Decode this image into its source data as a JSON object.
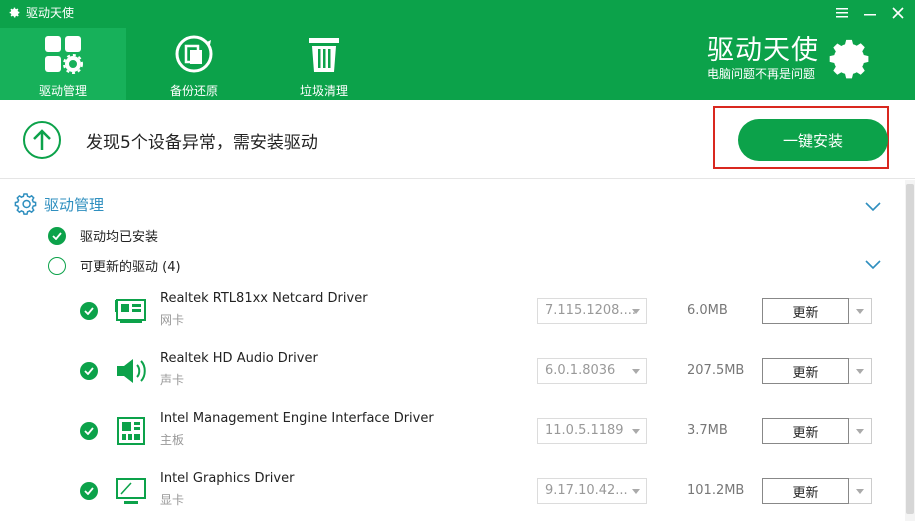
{
  "window": {
    "title": "驱动天使",
    "controls": [
      "menu-icon",
      "minimize-icon",
      "close-icon"
    ]
  },
  "nav": [
    {
      "label": "驱动管理",
      "icon": "driver-manage-icon",
      "active": true
    },
    {
      "label": "备份还原",
      "icon": "backup-restore-icon",
      "active": false
    },
    {
      "label": "垃圾清理",
      "icon": "trash-icon",
      "active": false
    }
  ],
  "brand": {
    "title": "驱动天使",
    "subtitle": "电脑问题不再是问题",
    "icon": "gear-icon"
  },
  "alert": {
    "icon": "up-arrow-circle-icon",
    "message": "发现5个设备异常，需安装驱动",
    "install_button": "一键安装"
  },
  "section": {
    "title": "驱动管理",
    "installed_label": "驱动均已安装",
    "updatable_label": "可更新的驱动 (4)"
  },
  "drivers": [
    {
      "name": "Realtek RTL81xx Netcard Driver",
      "type": "网卡",
      "version": "7.115.1208....",
      "size": "6.0MB",
      "action": "更新",
      "icon": "network-card-icon"
    },
    {
      "name": "Realtek HD Audio Driver",
      "type": "声卡",
      "version": "6.0.1.8036",
      "size": "207.5MB",
      "action": "更新",
      "icon": "speaker-icon"
    },
    {
      "name": "Intel Management Engine Interface Driver",
      "type": "主板",
      "version": "11.0.5.1189",
      "size": "3.7MB",
      "action": "更新",
      "icon": "motherboard-icon"
    },
    {
      "name": "Intel Graphics Driver",
      "type": "显卡",
      "version": "9.17.10.42...",
      "size": "101.2MB",
      "action": "更新",
      "icon": "monitor-icon"
    }
  ],
  "colors": {
    "primary_green": "#0ca24a",
    "active_tab": "#17b15a",
    "section_blue": "#2f8fbf",
    "highlight_red": "#d9281f"
  }
}
